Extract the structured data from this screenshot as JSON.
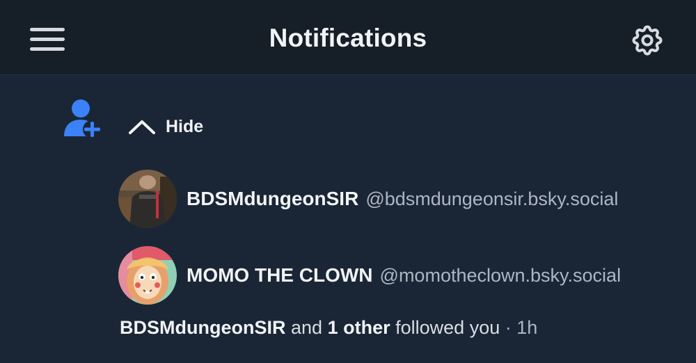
{
  "header": {
    "title": "Notifications",
    "menu_icon": "hamburger-menu-icon",
    "settings_icon": "gear-icon"
  },
  "notification": {
    "type_icon": "person-plus-icon",
    "accent_color": "#3b82f6",
    "toggle_label": "Hide",
    "toggle_icon": "chevron-up-icon",
    "users": [
      {
        "display_name": "BDSMdungeonSIR",
        "handle": "@bdsmdungeonsir.bsky.social"
      },
      {
        "display_name": "MOMO THE CLOWN",
        "handle": "@momotheclown.bsky.social"
      }
    ],
    "summary": {
      "actor": "BDSMdungeonSIR",
      "connector": "and",
      "others": "1 other",
      "action": "followed you",
      "separator": "·",
      "time": "1h"
    }
  }
}
